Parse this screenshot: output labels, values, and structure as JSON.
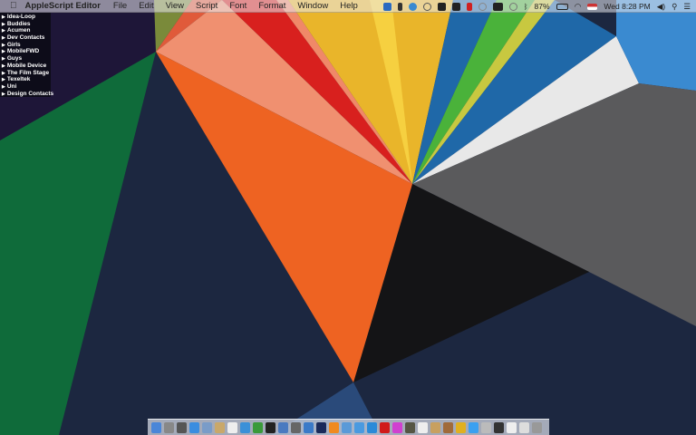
{
  "menubar": {
    "apple": "",
    "app_name": "AppleScript Editor",
    "menus": [
      "File",
      "Edit",
      "View",
      "Script",
      "Font",
      "Format",
      "Window",
      "Help"
    ]
  },
  "status": {
    "battery": "87%",
    "clock": "Wed 8:28 PM",
    "icons": [
      "twitter-icon",
      "bookmark-icon",
      "sync-icon",
      "help-circle-icon",
      "evernote-icon",
      "evernote-icon",
      "red-app-icon",
      "dropbox-icon",
      "airplay-icon",
      "time-machine-icon",
      "bluetooth-icon",
      "battery-icon",
      "wifi-icon",
      "us-flag-icon",
      "volume-icon",
      "spotlight-icon",
      "notification-center-icon"
    ]
  },
  "list": {
    "items": [
      "Idea-Loop",
      "Buddies",
      "Acumen",
      "Dev Contacts",
      "Girls",
      "MobileFWD",
      "Guys",
      "Mobile Device",
      "The Film Stage",
      "Texeltek",
      "Uni",
      "Design Contacts"
    ]
  },
  "dock": {
    "icons": [
      {
        "name": "finder",
        "color": "#4a86d8"
      },
      {
        "name": "system-preferences",
        "color": "#888"
      },
      {
        "name": "launchpad",
        "color": "#555"
      },
      {
        "name": "app-store",
        "color": "#3a8de0"
      },
      {
        "name": "preview",
        "color": "#7a9cc8"
      },
      {
        "name": "notes",
        "color": "#c9a86a"
      },
      {
        "name": "calendar",
        "color": "#eee"
      },
      {
        "name": "itunes",
        "color": "#3a90d8"
      },
      {
        "name": "adium",
        "color": "#3a9a3a"
      },
      {
        "name": "terminal",
        "color": "#222"
      },
      {
        "name": "keynote",
        "color": "#4a7ac0"
      },
      {
        "name": "script-editor",
        "color": "#666"
      },
      {
        "name": "instruments",
        "color": "#3a7ac8"
      },
      {
        "name": "photoshop",
        "color": "#1a2a5a"
      },
      {
        "name": "h-app",
        "color": "#f08a20"
      },
      {
        "name": "xcode",
        "color": "#5a9ad8"
      },
      {
        "name": "safari",
        "color": "#4a9ae0"
      },
      {
        "name": "twitter",
        "color": "#2a8ad8"
      },
      {
        "name": "record",
        "color": "#d01a1a"
      },
      {
        "name": "flower-app",
        "color": "#d040d0"
      },
      {
        "name": "monitor",
        "color": "#554"
      },
      {
        "name": "textedit",
        "color": "#eee"
      },
      {
        "name": "archive",
        "color": "#c8a060"
      },
      {
        "name": "characters",
        "color": "#a06a3a"
      },
      {
        "name": "chrome",
        "color": "#e0b020"
      },
      {
        "name": "messages",
        "color": "#3aa0f0"
      },
      {
        "name": "folder-apps",
        "color": "#bbb"
      },
      {
        "name": "folder-terminal",
        "color": "#333"
      },
      {
        "name": "folder-docs",
        "color": "#eee"
      },
      {
        "name": "folder-downloads",
        "color": "#ddd"
      },
      {
        "name": "trash",
        "color": "#999"
      }
    ]
  },
  "colors": {
    "navy": "#1c2740",
    "orange": "#ee6322",
    "green": "#0f6b3a",
    "purple": "#1e1638"
  }
}
